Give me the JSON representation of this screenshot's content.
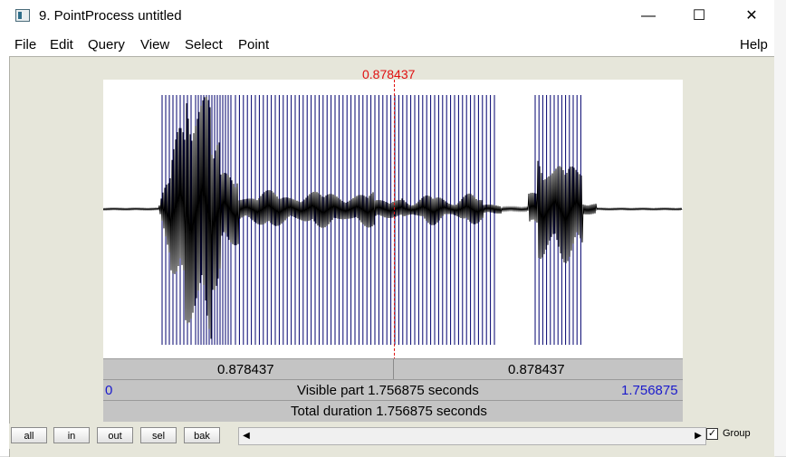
{
  "window": {
    "title": "9. PointProcess untitled",
    "minimize": "—",
    "maximize": "☐",
    "close": "✕"
  },
  "menu": {
    "items": [
      "File",
      "Edit",
      "Query",
      "View",
      "Select",
      "Point"
    ],
    "help": "Help"
  },
  "cursor": {
    "time_label": "0.878437"
  },
  "bars": {
    "left_time": "0.878437",
    "right_time": "0.878437",
    "visible_start": "0",
    "visible_text": "Visible part 1.756875 seconds",
    "visible_end": "1.756875",
    "total_text": "Total duration 1.756875 seconds"
  },
  "buttons": {
    "all": "all",
    "in": "in",
    "out": "out",
    "sel": "sel",
    "bak": "bak"
  },
  "scroll": {
    "left_arrow": "◀",
    "right_arrow": "▶"
  },
  "group": {
    "label": "Group",
    "checked": true,
    "check_glyph": "✓"
  },
  "colors": {
    "pulse_lines": "#00006e",
    "waveform": "#000000",
    "cursor": "#e01010",
    "blue_text": "#1a1acc"
  }
}
